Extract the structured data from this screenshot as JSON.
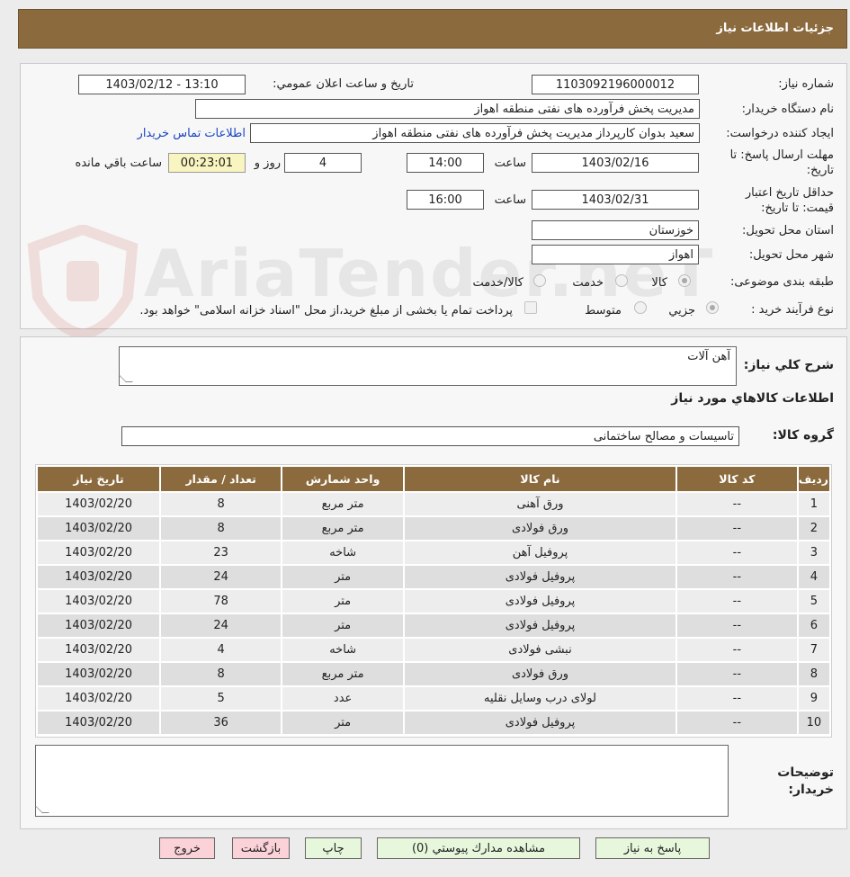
{
  "header": {
    "title": "جزئیات اطلاعات نیاز"
  },
  "form": {
    "need_number": {
      "label": "شماره نیاز:",
      "value": "1103092196000012"
    },
    "announce_datetime": {
      "label": "تاریخ و ساعت اعلان عمومي:",
      "value": "1403/02/12 - 13:10"
    },
    "buyer_org": {
      "label": "نام دستگاه خريدار:",
      "value": "مدیریت پخش فرآورده های نفتی منطقه اهواز"
    },
    "requester": {
      "label": "ایجاد کننده درخواست:",
      "value": "سعید بدوان کارپرداز مدیریت پخش فرآورده های نفتی منطقه اهواز",
      "contact_link": "اطلاعات تماس خریدار"
    },
    "reply_deadline": {
      "label": "مهلت ارسال پاسخ: تا تاریخ:",
      "date": "1403/02/16",
      "time_label": "ساعت",
      "time": "14:00",
      "days": "4",
      "days_label": "روز و",
      "remaining": "00:23:01",
      "remaining_label": "ساعت باقي مانده"
    },
    "price_validity": {
      "label": "حداقل تاریخ اعتبار قیمت: تا تاریخ:",
      "date": "1403/02/31",
      "time_label": "ساعت",
      "time": "16:00"
    },
    "province": {
      "label": "استان محل تحویل:",
      "value": "خوزستان"
    },
    "city": {
      "label": "شهر محل تحویل:",
      "value": "اهواز"
    },
    "category": {
      "label": "طبقه بندی موضوعی:",
      "options": [
        "کالا",
        "خدمت",
        "کالا/خدمت"
      ],
      "selected": "کالا"
    },
    "purchase_type": {
      "label": "نوع فرآیند خرید :",
      "options": [
        "جزيي",
        "متوسط"
      ],
      "selected": "جزيي",
      "treasury_note": "پرداخت تمام یا بخشی از مبلغ خرید،از محل \"اسناد خزانه اسلامی\" خواهد بود."
    }
  },
  "details": {
    "summary_label": "شرح کلي نیاز:",
    "summary_value": "آهن آلات",
    "goods_info_title": "اطلاعات کالاهاي مورد نیاز",
    "goods_group_label": "گروه کالا:",
    "goods_group_value": "تاسیسات و مصالح ساختمانی",
    "buyer_notes_label": "توضیحات خریدار:",
    "buyer_notes_value": ""
  },
  "table": {
    "headers": [
      "رديف",
      "کد کالا",
      "نام کالا",
      "واحد شمارش",
      "تعداد / مقدار",
      "تاریخ نیاز"
    ],
    "rows": [
      [
        "1",
        "--",
        "ورق آهنی",
        "متر مربع",
        "8",
        "1403/02/20"
      ],
      [
        "2",
        "--",
        "ورق فولادی",
        "متر مربع",
        "8",
        "1403/02/20"
      ],
      [
        "3",
        "--",
        "پروفیل آهن",
        "شاخه",
        "23",
        "1403/02/20"
      ],
      [
        "4",
        "--",
        "پروفیل فولادی",
        "متر",
        "24",
        "1403/02/20"
      ],
      [
        "5",
        "--",
        "پروفیل فولادی",
        "متر",
        "78",
        "1403/02/20"
      ],
      [
        "6",
        "--",
        "پروفیل فولادی",
        "متر",
        "24",
        "1403/02/20"
      ],
      [
        "7",
        "--",
        "نبشی فولادی",
        "شاخه",
        "4",
        "1403/02/20"
      ],
      [
        "8",
        "--",
        "ورق فولادی",
        "متر مربع",
        "8",
        "1403/02/20"
      ],
      [
        "9",
        "--",
        "لولای درب وسایل نقلیه",
        "عدد",
        "5",
        "1403/02/20"
      ],
      [
        "10",
        "--",
        "پروفیل فولادی",
        "متر",
        "36",
        "1403/02/20"
      ]
    ]
  },
  "buttons": {
    "reply": "پاسخ به نیاز",
    "attachments": "مشاهده مدارك پيوستي (0)",
    "print": "چاپ",
    "back": "بازگشت",
    "exit": "خروج"
  },
  "watermark": {
    "text": "AriaTender.neT"
  },
  "colors": {
    "header_brown": "#8b6a3e",
    "link_blue": "#1a45c4",
    "button_green": "#e7f7dc",
    "button_pink": "#fad2d8"
  }
}
